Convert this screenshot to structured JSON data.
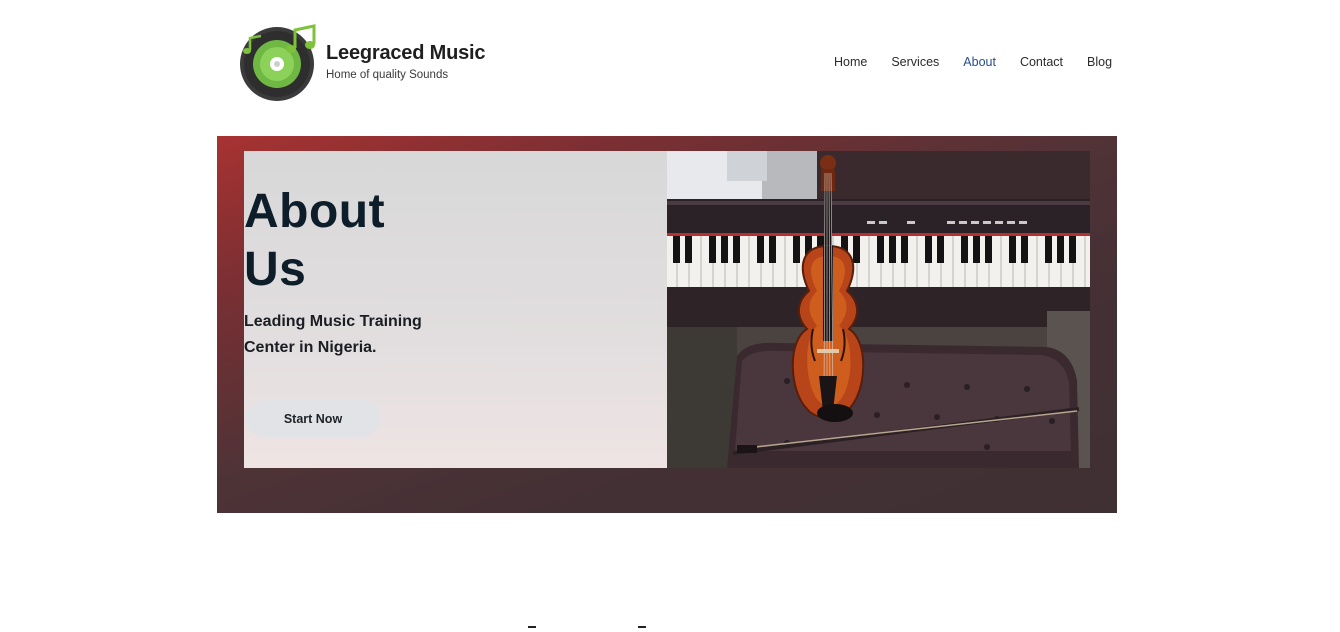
{
  "brand": {
    "name": "Leegraced Music",
    "tagline": "Home of quality Sounds",
    "logo_icon": "music-disc-logo",
    "accent_color": "#7dc23a"
  },
  "nav": {
    "items": [
      {
        "label": "Home",
        "active": false
      },
      {
        "label": "Services",
        "active": false
      },
      {
        "label": "About",
        "active": true
      },
      {
        "label": "Contact",
        "active": false
      },
      {
        "label": "Blog",
        "active": false
      }
    ],
    "active_color": "#2a4d8f"
  },
  "hero": {
    "title_line1": "About",
    "title_line2": "Us",
    "subtitle_line1": "Leading Music Training",
    "subtitle_line2": "Center in Nigeria.",
    "button_label": "Start Now",
    "image_icon": "violin-piano-photo",
    "background_top": "#a83232",
    "background_bottom": "#3f3034"
  }
}
